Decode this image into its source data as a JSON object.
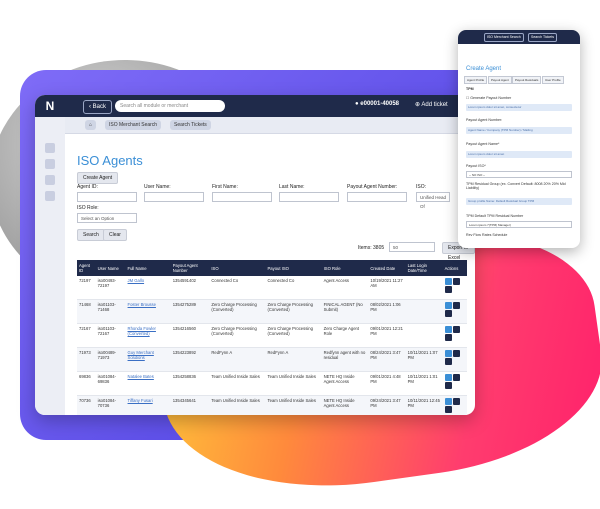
{
  "app": {
    "logo": "N"
  },
  "topbar": {
    "back": "Back",
    "search_placeholder": "Search all module or merchant",
    "account": "e00001-40058",
    "add_ticket": "Add ticket"
  },
  "subbar": {
    "iso_search": "ISO Merchant Search",
    "search_tickets": "Search Tickets"
  },
  "page": {
    "title": "ISO Agents",
    "create_agent": "Create Agent"
  },
  "filters": {
    "agent_id": "Agent ID:",
    "user_name": "User Name:",
    "first_name": "First Name:",
    "last_name": "Last Name:",
    "payout_agent_number": "Payout Agent Number:",
    "iso": "ISO:",
    "iso_value": "Unified Head Of",
    "iso_role": "ISO Role:",
    "iso_role_placeholder": "Select an Option",
    "search": "Search",
    "clear": "Clear"
  },
  "table_controls": {
    "items_label": "Items: 3805",
    "per_page": "50",
    "export": "Export to Excel"
  },
  "table": {
    "columns": [
      "Agent ID",
      "User Name",
      "Full Name",
      "Payout Agent Number",
      "ISO",
      "Payout ISO",
      "ISO Role",
      "Created Date",
      "Last Login Date/Time",
      "Actions"
    ],
    "rows": [
      [
        "72197",
        "iso00493-72197",
        "JM Gallo",
        "1354591402",
        "Connected Co",
        "Connected Co",
        "Agent Access",
        "10/19/2021 11:27 AM",
        "",
        ""
      ],
      [
        "71468",
        "iso01103-71468",
        "Foster Brousse",
        "1354275289",
        "Zero Charge Processing (Converted)",
        "Zero Charge Processing (Converted)",
        "FINICAL AGENT (No Submit)",
        "08/02/2021 1:06 PM",
        "",
        ""
      ],
      [
        "72167",
        "iso01103-72167",
        "Rhonda Fowler (Converted)",
        "1354216560",
        "Zero Charge Processing (Converted)",
        "Zero Charge Processing (Converted)",
        "Zero Charge Agent Role",
        "09/01/2021 12:21 PM",
        "",
        ""
      ],
      [
        "71973",
        "iso00489-71973",
        "Guy Merchant Solutions",
        "1354223892",
        "RedFynn A",
        "RedFynn A",
        "Redfynn agent with no residual",
        "08/24/2021 3:47 PM",
        "10/11/2021 1:07 PM",
        ""
      ],
      [
        "69836",
        "iso01084-69836",
        "Natalee Bates",
        "1354258836",
        "Team Unified Inside Sales",
        "Team Unified Inside Sales",
        "NETE HQ Inside Agent Access",
        "09/01/2021 4:48 PM",
        "10/11/2021 1:01 PM",
        ""
      ],
      [
        "70736",
        "iso01084-70736",
        "Tiffany Fusari",
        "1354345641",
        "Team Unified Inside Sales",
        "Team Unified Inside Sales",
        "NETE HQ Inside Agent Access",
        "09/24/2021 3:47 PM",
        "10/11/2021 12:45 PM",
        ""
      ]
    ]
  },
  "panel": {
    "top_btn1": "ISO Merchant Search",
    "top_btn2": "Search Tickets",
    "title": "Create Agent",
    "tabs": [
      "Agent Profile",
      "Payout Agent",
      "Payout Residuals",
      "User Profile"
    ],
    "section": "TPM",
    "l1": "Generate Payout Number",
    "f1": "Lorem ipsum dolor sit amet, consectetur",
    "l2": "Payout Agent Number:",
    "f2": "Agent Name / Company (TPM Number) / Mailing",
    "l3": "Payout Agent Name*",
    "f3": "Lorem ipsum dolor sit amet",
    "l4": "Payout ISO*",
    "sel1": "-- NO ISO --",
    "l5": "TPM Residual Group (ex. Convert Default: 8008 20% 20% Mid Liability)",
    "f4": "Group profile Name: Default Residual Group TPM",
    "l6": "TPM Default TPM Residual Number",
    "sel2": "Lorem ipsum 7(TPM) Manager)",
    "l7": "Rev Flow Rates Schedule"
  },
  "colors": {
    "navy": "#1f2a4a",
    "accent": "#3b8fd6",
    "link": "#3a6fc4"
  }
}
